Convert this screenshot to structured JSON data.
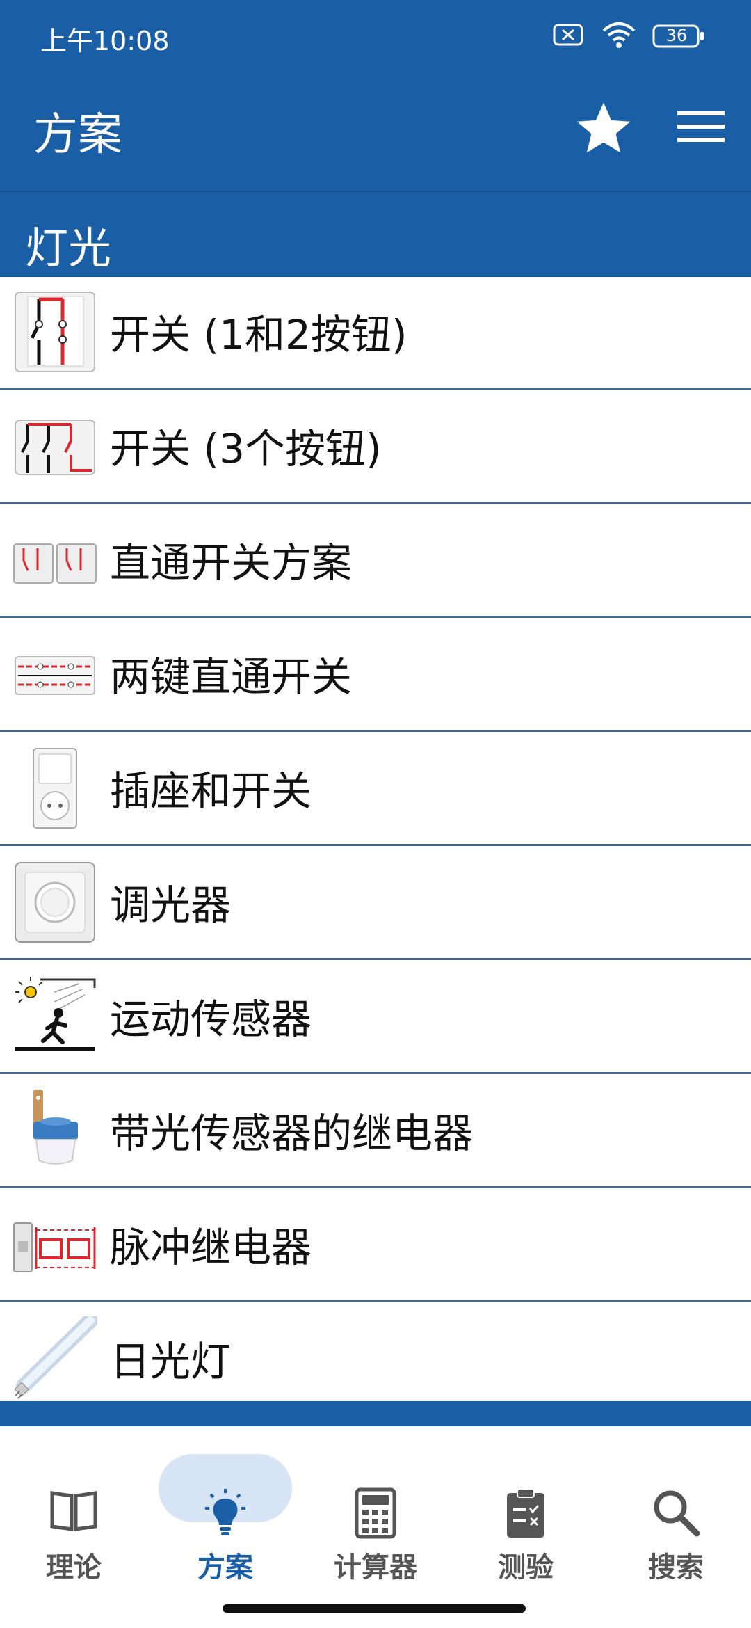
{
  "status": {
    "time": "上午10:08",
    "battery": "36"
  },
  "appbar": {
    "title": "方案"
  },
  "section": {
    "title": "灯光"
  },
  "items": [
    {
      "label": "开关 (1和2按钮)",
      "icon": "switch-1-2-diagram-icon"
    },
    {
      "label": "开关 (3个按钮)",
      "icon": "switch-3-diagram-icon"
    },
    {
      "label": "直通开关方案",
      "icon": "pass-through-switch-icon"
    },
    {
      "label": "两键直通开关",
      "icon": "two-key-pass-through-icon"
    },
    {
      "label": "插座和开关",
      "icon": "socket-switch-icon"
    },
    {
      "label": "调光器",
      "icon": "dimmer-icon"
    },
    {
      "label": "运动传感器",
      "icon": "motion-sensor-icon"
    },
    {
      "label": "带光传感器的继电器",
      "icon": "light-sensor-relay-icon"
    },
    {
      "label": "脉冲继电器",
      "icon": "pulse-relay-icon"
    },
    {
      "label": "日光灯",
      "icon": "fluorescent-lamp-icon"
    }
  ],
  "nav": [
    {
      "label": "理论",
      "icon": "book-icon",
      "active": false
    },
    {
      "label": "方案",
      "icon": "lightbulb-icon",
      "active": true
    },
    {
      "label": "计算器",
      "icon": "calculator-icon",
      "active": false
    },
    {
      "label": "测验",
      "icon": "clipboard-icon",
      "active": false
    },
    {
      "label": "搜索",
      "icon": "search-icon",
      "active": false
    }
  ],
  "colors": {
    "primary": "#1a5ea6",
    "pill": "#d6e4f6",
    "divider": "#44678e",
    "accent_red": "#d9282f"
  }
}
